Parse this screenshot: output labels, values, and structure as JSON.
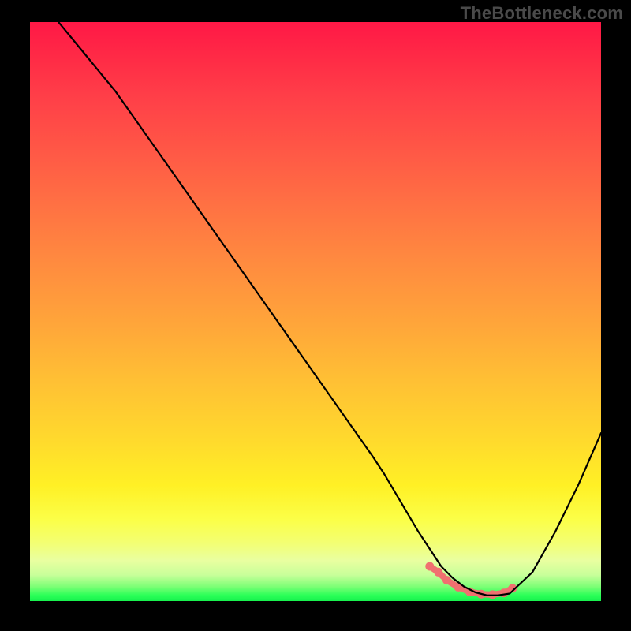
{
  "watermark": "TheBottleneck.com",
  "chart_data": {
    "type": "line",
    "title": "",
    "xlabel": "",
    "ylabel": "",
    "xlim": [
      0,
      100
    ],
    "ylim": [
      0,
      100
    ],
    "grid": false,
    "series": [
      {
        "name": "bottleneck-curve",
        "x": [
          5,
          10,
          15,
          20,
          25,
          30,
          35,
          40,
          45,
          50,
          55,
          60,
          62,
          65,
          68,
          70,
          72,
          74,
          76,
          78,
          80,
          82,
          84,
          88,
          92,
          96,
          100
        ],
        "values": [
          100,
          94,
          88,
          81,
          74,
          67,
          60,
          53,
          46,
          39,
          32,
          25,
          22,
          17,
          12,
          9,
          6,
          4,
          2.5,
          1.5,
          1,
          1,
          1.3,
          5,
          12,
          20,
          29
        ]
      }
    ],
    "optimal_zone": {
      "name": "optimal-range-markers",
      "x": [
        70,
        71.5,
        73,
        75,
        77,
        79,
        81,
        83,
        84.5
      ],
      "values": [
        6,
        5,
        3.6,
        2.4,
        1.6,
        1.2,
        1.1,
        1.4,
        2.2
      ]
    },
    "colors": {
      "curve": "#000000",
      "optimal_markers": "#f07070",
      "background_top": "#ff1846",
      "background_bottom": "#17f24e"
    }
  }
}
